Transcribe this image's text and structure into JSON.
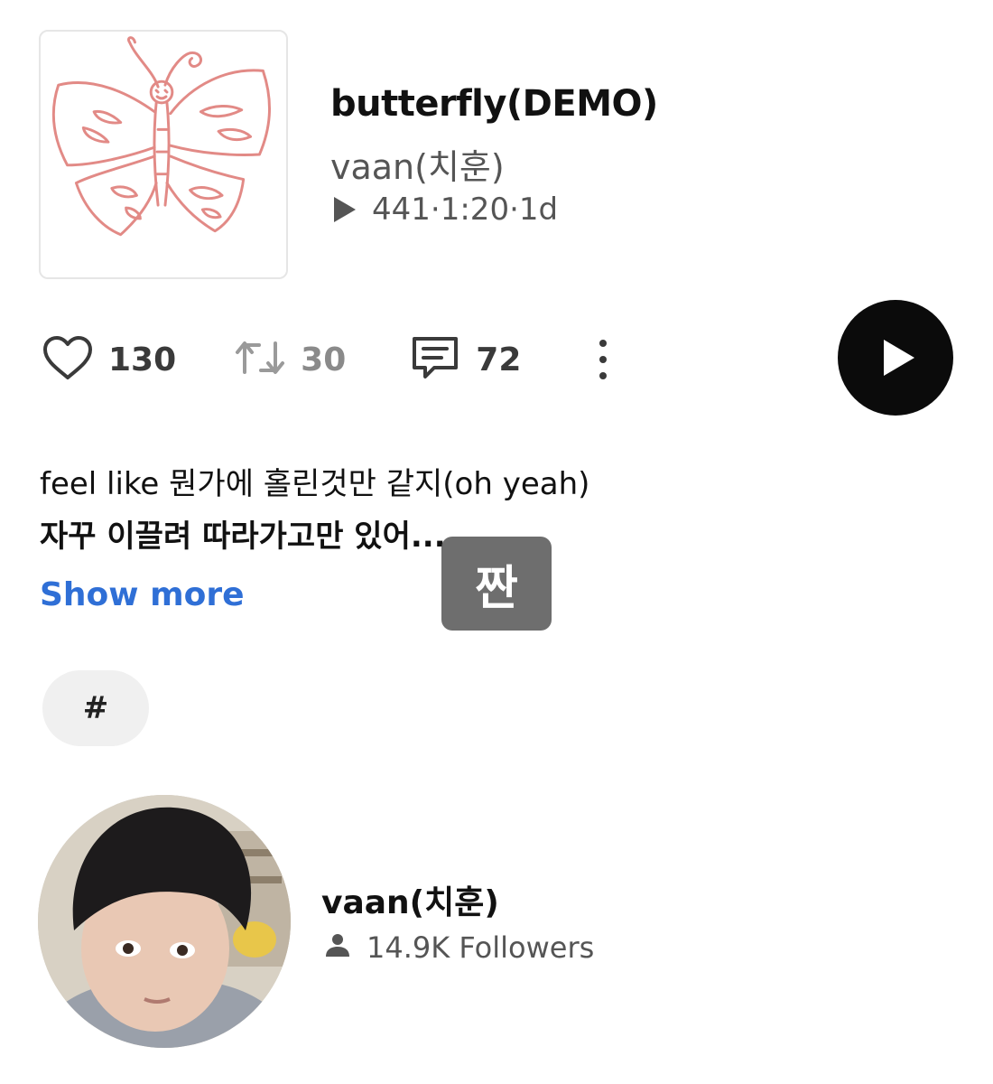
{
  "track": {
    "title": "butterfly(DEMO)",
    "artist": "vaan(치훈)",
    "plays": "441",
    "duration": "1:20",
    "age": "1d",
    "meta_separator": " · "
  },
  "actions": {
    "likes": "130",
    "reposts": "30",
    "comments": "72"
  },
  "description": {
    "line1": "feel like 뭔가에 홀린것만 같지(oh yeah)",
    "line2": "자꾸 이끌려 따라가고만 있어...",
    "show_more_label": "Show more"
  },
  "sticker_text": "짠",
  "tag_label": "#",
  "profile": {
    "name": "vaan(치훈)",
    "followers": "14.9K Followers"
  },
  "colors": {
    "link": "#2f6fd6",
    "play_button": "#0b0b0b",
    "artwork_stroke": "#e28a86",
    "repost_muted": "#8a8a8a"
  },
  "icons": {
    "like": "heart-icon",
    "repost": "repost-icon",
    "comment": "comment-icon",
    "more": "vertical-dots-icon",
    "play": "play-icon",
    "followers": "person-icon"
  }
}
